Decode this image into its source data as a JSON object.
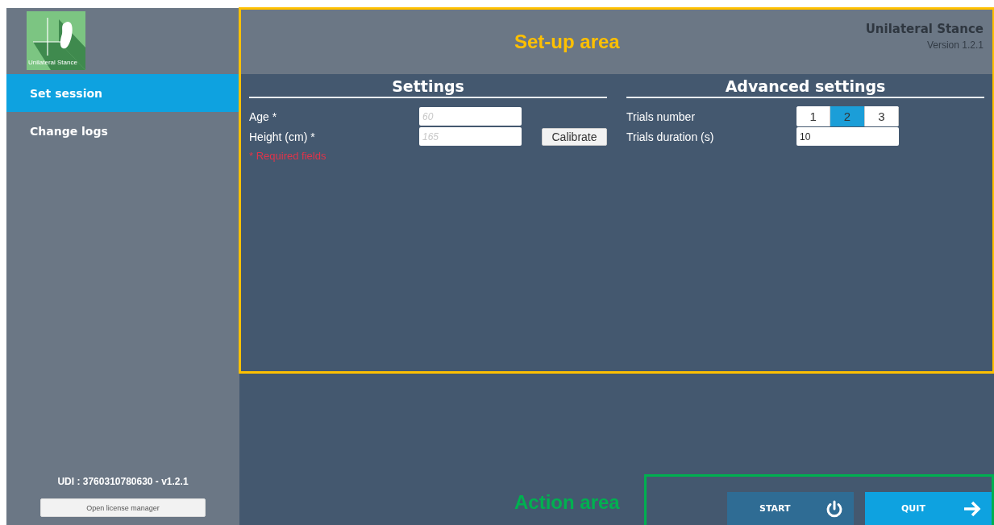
{
  "sidebar": {
    "logo_caption": "Unilateral Stance",
    "items": [
      {
        "label": "Set session",
        "selected": true
      },
      {
        "label": "Change logs",
        "selected": false
      }
    ],
    "udi": "UDI : 3760310780630 - v1.2.1",
    "license_button": "Open license manager"
  },
  "header": {
    "title": "Unilateral Stance",
    "version": "Version 1.2.1"
  },
  "settings": {
    "title": "Settings",
    "fields": [
      {
        "label": "Age *",
        "placeholder": "60"
      },
      {
        "label": "Height (cm) *",
        "placeholder": "165",
        "button": "Calibrate"
      }
    ],
    "required_note": "* Required fields"
  },
  "advanced_settings": {
    "title": "Advanced settings",
    "trials_number": {
      "label": "Trials number",
      "options": [
        {
          "label": "1",
          "selected": false
        },
        {
          "label": "2",
          "selected": true
        },
        {
          "label": "3",
          "selected": false
        }
      ]
    },
    "trials_duration": {
      "label": "Trials duration (s)",
      "value": "10"
    }
  },
  "actions": [
    {
      "label": "START",
      "kind": "power"
    },
    {
      "label": "QUIT",
      "kind": "arrow"
    }
  ],
  "annotations": [
    {
      "label": "Set-up area",
      "color": "#ffc000"
    },
    {
      "label": "Action area",
      "color": "#00b050"
    }
  ]
}
